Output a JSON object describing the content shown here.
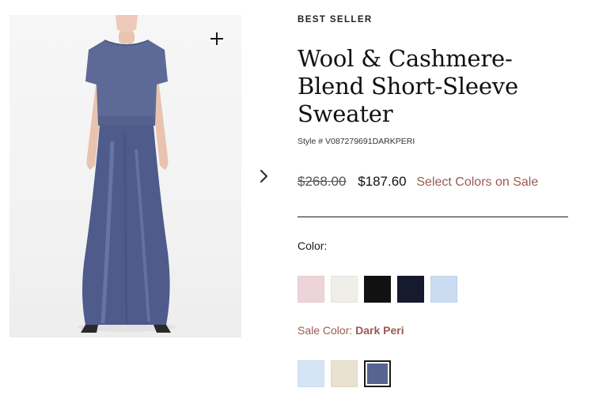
{
  "product": {
    "badge": "BEST SELLER",
    "title": "Wool & Cashmere-Blend Short-Sleeve Sweater",
    "style_number": "Style # V087279691DARKPERI",
    "price_original": "$268.00",
    "price_sale": "$187.60",
    "sale_link_label": "Select Colors on Sale"
  },
  "gallery": {
    "zoom_icon": "plus-icon",
    "next_icon": "chevron-right-icon"
  },
  "colors": {
    "label": "Color:",
    "swatches": [
      {
        "name": "pink",
        "hex": "#ecd4d9"
      },
      {
        "name": "off-white",
        "hex": "#efeee9"
      },
      {
        "name": "black",
        "hex": "#111111"
      },
      {
        "name": "navy",
        "hex": "#161a2e"
      },
      {
        "name": "light-blue",
        "hex": "#c9dcf1"
      }
    ]
  },
  "sale_colors": {
    "label": "Sale Color:",
    "selected": "Dark Peri",
    "swatches": [
      {
        "name": "light-blue",
        "hex": "#d6e5f6"
      },
      {
        "name": "cream",
        "hex": "#e9e1cf"
      },
      {
        "name": "dark-peri",
        "hex": "#56648f",
        "selected": true
      }
    ]
  }
}
